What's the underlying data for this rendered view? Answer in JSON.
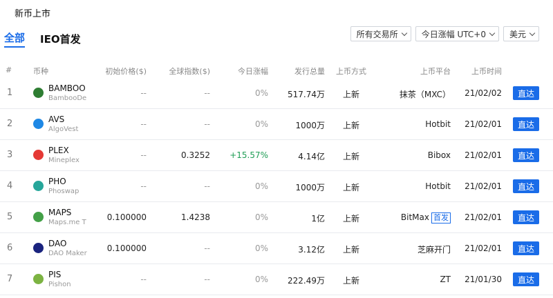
{
  "page_title": "新币上市",
  "tabs": [
    {
      "label": "全部",
      "active": true
    },
    {
      "label": "IEO首发",
      "active": false
    }
  ],
  "filters": {
    "exchange": "所有交易所",
    "change_period": "今日涨幅 UTC+0",
    "currency": "美元"
  },
  "columns": {
    "index": "#",
    "coin": "币种",
    "initial_price": "初始价格($)",
    "global_index": "全球指数($)",
    "today_change": "今日涨幅",
    "total_supply": "发行总量",
    "listing_method": "上币方式",
    "platform": "上币平台",
    "listing_time": "上币时间"
  },
  "go_label": "直达",
  "rows": [
    {
      "index": "1",
      "symbol": "BAMBOO",
      "name": "BambooDe",
      "icon_color": "#2e7d32",
      "init": "--",
      "global": "--",
      "change": "0%",
      "supply": "517.74万",
      "method": "上新",
      "platform": "抹茶（MXC）",
      "badge": "",
      "date": "21/02/02"
    },
    {
      "index": "2",
      "symbol": "AVS",
      "name": "AlgoVest",
      "icon_color": "#1e88e5",
      "init": "--",
      "global": "--",
      "change": "0%",
      "supply": "1000万",
      "method": "上新",
      "platform": "Hotbit",
      "badge": "",
      "date": "21/02/01"
    },
    {
      "index": "3",
      "symbol": "PLEX",
      "name": "Mineplex",
      "icon_color": "#e53935",
      "init": "--",
      "global": "0.3252",
      "change": "+15.57%",
      "supply": "4.14亿",
      "method": "上新",
      "platform": "Bibox",
      "badge": "",
      "date": "21/02/01"
    },
    {
      "index": "4",
      "symbol": "PHO",
      "name": "Phoswap",
      "icon_color": "#26a69a",
      "init": "--",
      "global": "--",
      "change": "0%",
      "supply": "1000万",
      "method": "上新",
      "platform": "Hotbit",
      "badge": "",
      "date": "21/02/01"
    },
    {
      "index": "5",
      "symbol": "MAPS",
      "name": "Maps.me T",
      "icon_color": "#43a047",
      "init": "0.100000",
      "global": "1.4238",
      "change": "0%",
      "supply": "1亿",
      "method": "上新",
      "platform": "BitMax",
      "badge": "首发",
      "date": "21/02/01"
    },
    {
      "index": "6",
      "symbol": "DAO",
      "name": "DAO Maker",
      "icon_color": "#1a237e",
      "init": "0.100000",
      "global": "--",
      "change": "0%",
      "supply": "3.12亿",
      "method": "上新",
      "platform": "芝麻开门",
      "badge": "",
      "date": "21/02/01"
    },
    {
      "index": "7",
      "symbol": "PIS",
      "name": "Pishon",
      "icon_color": "#7cb342",
      "init": "--",
      "global": "--",
      "change": "0%",
      "supply": "222.49万",
      "method": "上新",
      "platform": "ZT",
      "badge": "",
      "date": "21/01/30"
    }
  ]
}
